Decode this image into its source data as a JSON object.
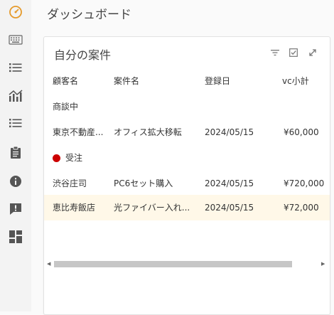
{
  "header": {
    "title": "ダッシュボード"
  },
  "sidebar": {
    "icons": [
      "dashboard-gauge",
      "keyboard",
      "list",
      "chart",
      "list",
      "clipboard",
      "info",
      "feedback",
      "grid"
    ]
  },
  "card": {
    "title": "自分の案件",
    "columns": [
      "顧客名",
      "案件名",
      "登録日",
      "vc小計"
    ],
    "groups": [
      {
        "label": "商談中",
        "rows": [
          {
            "customer": "東京不動産...",
            "project": "オフィス拡大移転",
            "date": "2024/05/15",
            "amount": "¥60,000"
          }
        ]
      },
      {
        "label": "受注",
        "rows": [
          {
            "customer": "渋谷庄司",
            "project": "PC6セット購入",
            "date": "2024/05/15",
            "amount": "¥720,000"
          },
          {
            "customer": "恵比寿飯店",
            "project": "光ファイバー入れ...",
            "date": "2024/05/15",
            "amount": "¥72,000"
          }
        ]
      }
    ]
  },
  "colors": {
    "accent": "#e59a2b",
    "won_marker": "#cc0000",
    "highlight_row": "#fff8e8"
  }
}
